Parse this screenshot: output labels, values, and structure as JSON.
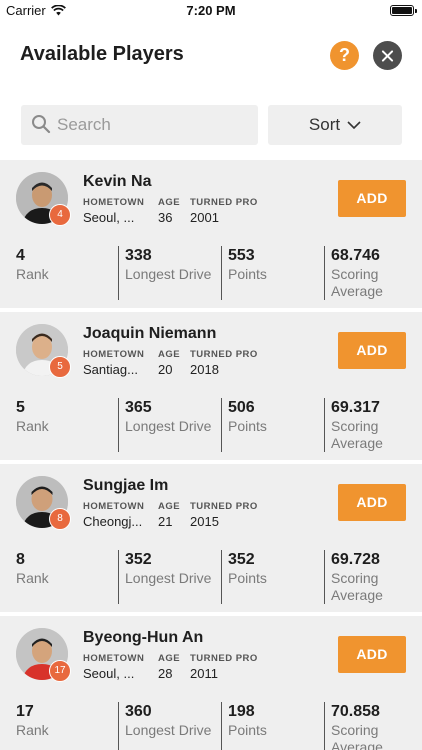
{
  "status_bar": {
    "carrier": "Carrier",
    "time": "7:20 PM"
  },
  "header": {
    "title": "Available Players",
    "help_label": "?"
  },
  "search": {
    "placeholder": "Search",
    "value": ""
  },
  "sort": {
    "label": "Sort"
  },
  "labels": {
    "hometown": "HOMETOWN",
    "age": "AGE",
    "turned_pro": "TURNED PRO",
    "add": "ADD",
    "rank": "Rank",
    "longest_drive": "Longest Drive",
    "points": "Points",
    "scoring_line1": "Scoring",
    "scoring_line2": "Average"
  },
  "colors": {
    "accent": "#f0942f",
    "badge": "#e8693e",
    "card_bg": "#efefef",
    "close_bg": "#4d4d4d"
  },
  "players": [
    {
      "name": "Kevin Na",
      "hometown": "Seoul, ...",
      "age": "36",
      "turned_pro": "2001",
      "badge": "4",
      "rank": "4",
      "longest_drive": "338",
      "points": "553",
      "scoring_average": "68.746",
      "shirt": "#1a1a1a",
      "bg": "#b9b9b9"
    },
    {
      "name": "Joaquin Niemann",
      "hometown": "Santiag...",
      "age": "20",
      "turned_pro": "2018",
      "badge": "5",
      "rank": "5",
      "longest_drive": "365",
      "points": "506",
      "scoring_average": "69.317",
      "shirt": "#f2f2f2",
      "bg": "#c9c9c9"
    },
    {
      "name": "Sungjae Im",
      "hometown": "Cheongj...",
      "age": "21",
      "turned_pro": "2015",
      "badge": "8",
      "rank": "8",
      "longest_drive": "352",
      "points": "352",
      "scoring_average": "69.728",
      "shirt": "#1a1a1a",
      "bg": "#bdbdbd"
    },
    {
      "name": "Byeong-Hun An",
      "hometown": "Seoul, ...",
      "age": "28",
      "turned_pro": "2011",
      "badge": "17",
      "rank": "17",
      "longest_drive": "360",
      "points": "198",
      "scoring_average": "70.858",
      "shirt": "#d8322a",
      "bg": "#c4c4c4"
    }
  ]
}
